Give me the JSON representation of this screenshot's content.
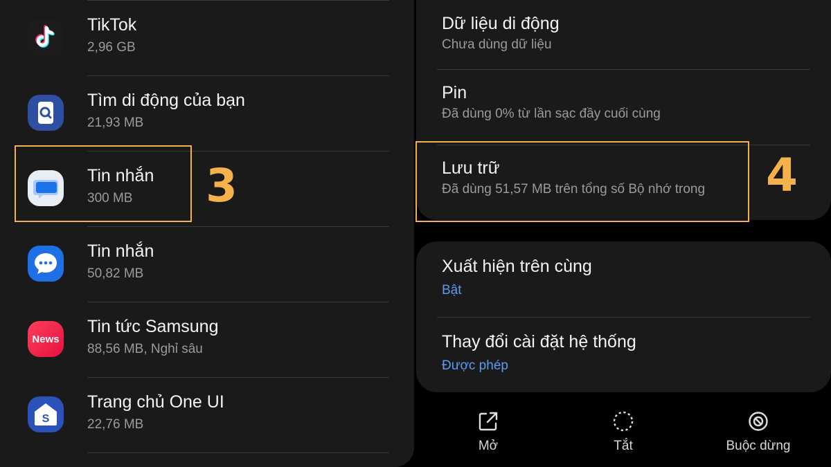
{
  "apps": [
    {
      "name": "TikTok",
      "size": "2,96 GB",
      "icon": "tiktok-icon"
    },
    {
      "name": "Tìm di động của bạn",
      "size": "21,93 MB",
      "icon": "find-my-mobile-icon"
    },
    {
      "name": "Tin nhắn",
      "size": "300 MB",
      "icon": "google-messages-icon"
    },
    {
      "name": "Tin nhắn",
      "size": "50,82 MB",
      "icon": "samsung-messages-icon"
    },
    {
      "name": "Tin tức Samsung",
      "size": "88,56 MB, Nghỉ sâu",
      "icon": "samsung-news-icon",
      "icon_text": "News"
    },
    {
      "name": "Trang chủ One UI",
      "size": "22,76 MB",
      "icon": "one-ui-home-icon"
    }
  ],
  "settings_top": [
    {
      "title": "Dữ liệu di động",
      "subtitle": "Chưa dùng dữ liệu"
    },
    {
      "title": "Pin",
      "subtitle": "Đã dùng 0% từ lần sạc đầy cuối cùng"
    },
    {
      "title": "Lưu trữ",
      "subtitle": "Đã dùng 51,57 MB trên tổng số Bộ nhớ trong"
    }
  ],
  "settings_bottom": [
    {
      "title": "Xuất hiện trên cùng",
      "subtitle": "Bật"
    },
    {
      "title": "Thay đổi cài đặt hệ thống",
      "subtitle": "Được phép"
    }
  ],
  "actions": [
    {
      "label": "Mở",
      "icon": "open-external-icon"
    },
    {
      "label": "Tắt",
      "icon": "disable-icon"
    },
    {
      "label": "Buộc dừng",
      "icon": "force-stop-icon"
    }
  ],
  "annotations": {
    "step3": "3",
    "step4": "4"
  },
  "colors": {
    "highlight": "#f6b24a",
    "link_blue": "#5b9bf0",
    "panel": "#1a1a1a"
  }
}
